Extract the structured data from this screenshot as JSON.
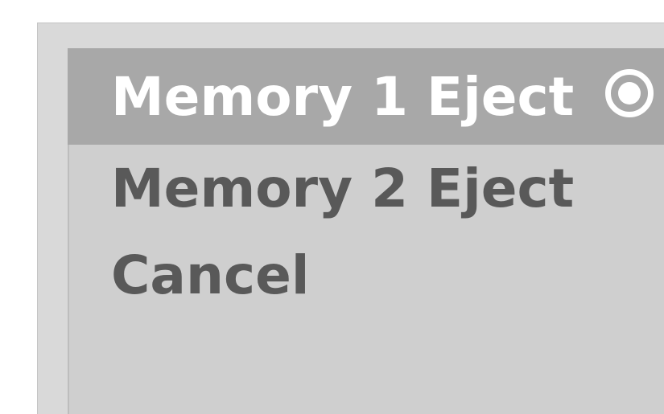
{
  "menu": {
    "items": [
      {
        "label": "Memory 1 Eject",
        "selected": true
      },
      {
        "label": "Memory 2 Eject",
        "selected": false
      },
      {
        "label": "Cancel",
        "selected": false
      }
    ]
  },
  "colors": {
    "outer_panel": "#d9d9d9",
    "inner_panel": "#cfcfcf",
    "highlight": "#a8a8a8",
    "selected_text": "#ffffff",
    "item_text": "#595959"
  },
  "icons": {
    "selected_indicator": "radio-selected-icon"
  }
}
